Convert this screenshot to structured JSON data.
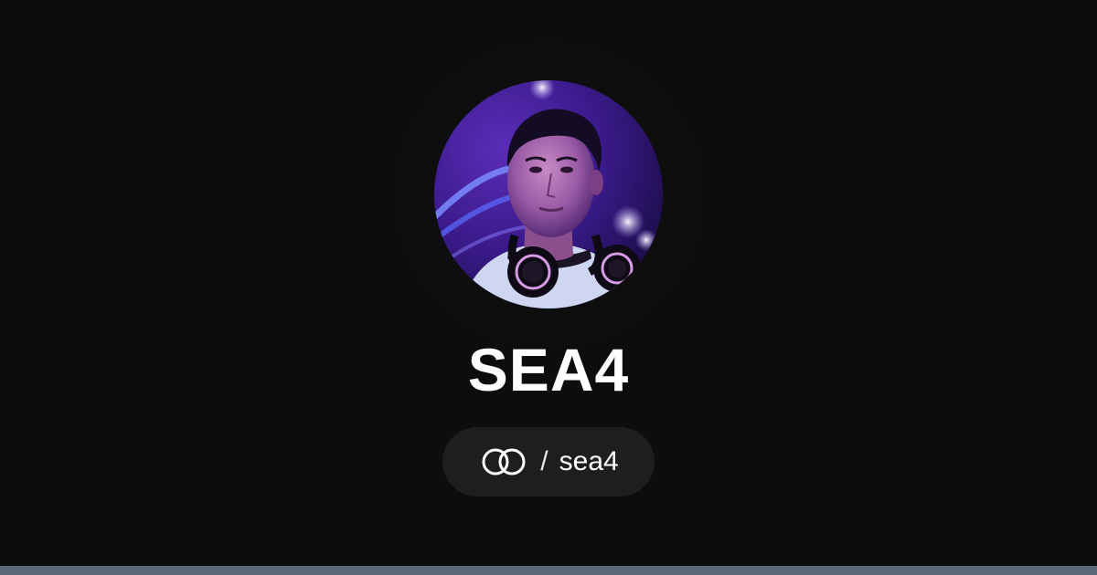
{
  "profile": {
    "display_name": "SEA4",
    "handle_separator": "/",
    "handle": "sea4",
    "avatar": "avatar-photo",
    "logo_icon": "linked-rings-icon"
  },
  "colors": {
    "background": "#0d0d0d",
    "pill_background": "#1e1e1e",
    "text": "#ffffff",
    "bottom_bar": "#5a6875"
  }
}
